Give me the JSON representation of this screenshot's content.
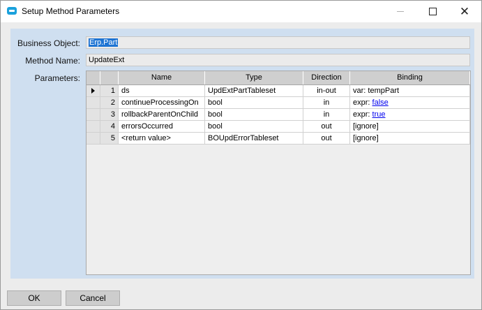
{
  "window": {
    "title": "Setup Method Parameters"
  },
  "form": {
    "business_object_label": "Business Object:",
    "business_object_value": "Erp.Part",
    "method_name_label": "Method Name:",
    "method_name_value": "UpdateExt",
    "parameters_label": "Parameters:"
  },
  "grid": {
    "columns": [
      "Name",
      "Type",
      "Direction",
      "Binding"
    ],
    "rows": [
      {
        "index": "1",
        "name": "ds",
        "type": "UpdExtPartTableset",
        "direction": "in-out",
        "binding_prefix": "var: ",
        "binding_value": "tempPart",
        "binding_link": false,
        "current": true
      },
      {
        "index": "2",
        "name": "continueProcessingOn",
        "type": "bool",
        "direction": "in",
        "binding_prefix": "expr: ",
        "binding_value": "false",
        "binding_link": true,
        "current": false
      },
      {
        "index": "3",
        "name": "rollbackParentOnChild",
        "type": "bool",
        "direction": "in",
        "binding_prefix": "expr: ",
        "binding_value": "true",
        "binding_link": true,
        "current": false
      },
      {
        "index": "4",
        "name": "errorsOccurred",
        "type": "bool",
        "direction": "out",
        "binding_prefix": "",
        "binding_value": "[ignore]",
        "binding_link": false,
        "current": false
      },
      {
        "index": "5",
        "name": "<return value>",
        "type": "BOUpdErrorTableset",
        "direction": "out",
        "binding_prefix": "",
        "binding_value": "[ignore]",
        "binding_link": false,
        "current": false
      }
    ]
  },
  "buttons": {
    "ok": "OK",
    "cancel": "Cancel"
  },
  "icons": {
    "app": "app-window-icon",
    "minimize": "minimize-icon",
    "maximize": "maximize-icon",
    "close": "close-icon",
    "row_pointer": "row-pointer-icon"
  },
  "colors": {
    "panel": "#cfdff0",
    "selection": "#1e74d3",
    "link": "#0000ee",
    "app_icon": "#1aa1dc"
  }
}
